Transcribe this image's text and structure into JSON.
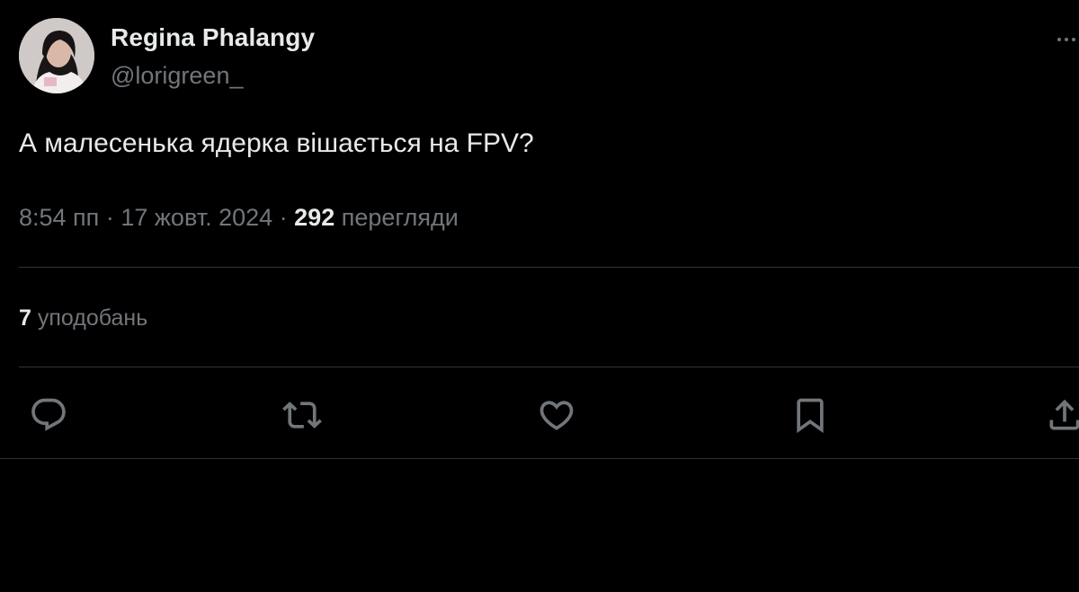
{
  "user": {
    "display_name": "Regina Phalangy",
    "handle": "@lorigreen_"
  },
  "tweet": {
    "text": "А малесенька ядерка вішається на FPV?",
    "time": "8:54 пп",
    "date": "17 жовт. 2024",
    "separator": "·",
    "views_count": "292",
    "views_label": "перегляди"
  },
  "stats": {
    "likes_count": "7",
    "likes_label": "уподобань"
  },
  "actions": [
    {
      "icon": "reply-icon"
    },
    {
      "icon": "retweet-icon"
    },
    {
      "icon": "heart-icon"
    },
    {
      "icon": "bookmark-icon"
    },
    {
      "icon": "share-icon"
    }
  ],
  "colors": {
    "background": "#000000",
    "primary_text": "#e7e9ea",
    "secondary_text": "#71767b",
    "divider": "#2f3336"
  }
}
